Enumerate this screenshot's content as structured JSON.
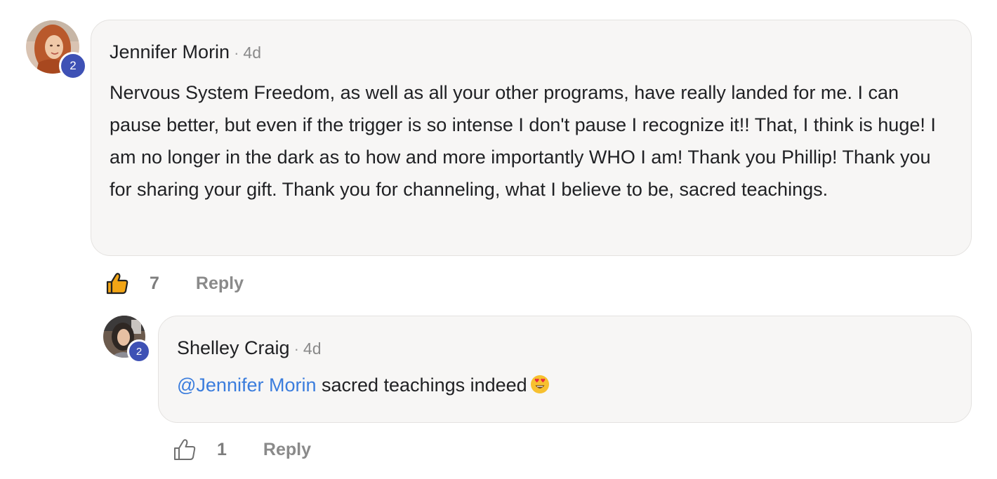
{
  "comments": [
    {
      "author": "Jennifer Morin",
      "separator": "·",
      "time": "4d",
      "level": "2",
      "text": "Nervous System Freedom, as well as all your other programs, have really landed for me. I can pause better, but even if the trigger is so intense I don't pause I recognize it!! That, I think is huge! I am no longer in the dark as to how and more importantly WHO I am! Thank you Phillip! Thank you for sharing your gift. Thank you for channeling, what I believe to be, sacred teachings.",
      "likes": "7",
      "liked": true,
      "reply_label": "Reply"
    }
  ],
  "replies": [
    {
      "author": "Shelley Craig",
      "separator": "·",
      "time": "4d",
      "level": "2",
      "mention": "@Jennifer Morin",
      "text": " sacred teachings indeed",
      "emoji": "heart-eyes-emoji",
      "likes": "1",
      "liked": false,
      "reply_label": "Reply"
    }
  ],
  "colors": {
    "badge": "#3e51b5",
    "mention": "#3b7ddd",
    "like_active": "#f2a516",
    "bubble_bg": "#f7f6f5"
  }
}
